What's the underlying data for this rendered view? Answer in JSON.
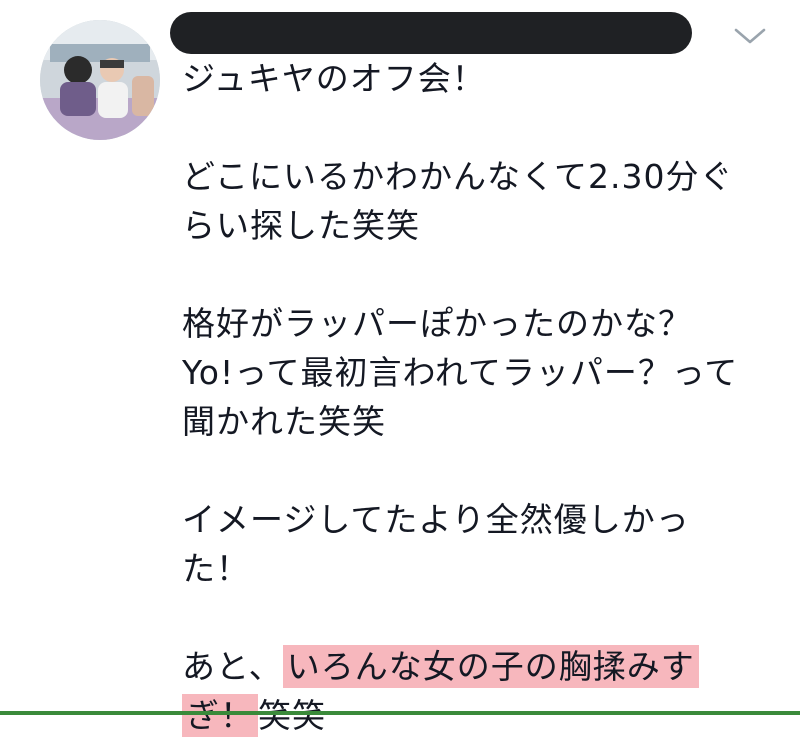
{
  "tweet": {
    "paragraphs": [
      {
        "lines": [
          "ジュキヤのオフ会！"
        ]
      },
      {
        "lines": [
          "どこにいるかわかんなくて2.30分ぐ",
          "らい探した笑笑"
        ]
      },
      {
        "lines": [
          "格好がラッパーぽかったのかな？",
          "Yo!って最初言われてラッパー？って",
          "聞かれた笑笑"
        ]
      },
      {
        "lines": [
          "イメージしてたより全然優しかっ",
          "た！"
        ]
      },
      {
        "line1_prefix": "あと、",
        "line1_highlight": "いろんな女の子の胸揉みす",
        "line2_highlight": "ぎ！",
        "line2_suffix": "笑笑"
      }
    ],
    "highlight_color": "#f7b7bd",
    "redaction_color": "#1f2124"
  },
  "icons": {
    "menu": "chevron-down-icon"
  }
}
